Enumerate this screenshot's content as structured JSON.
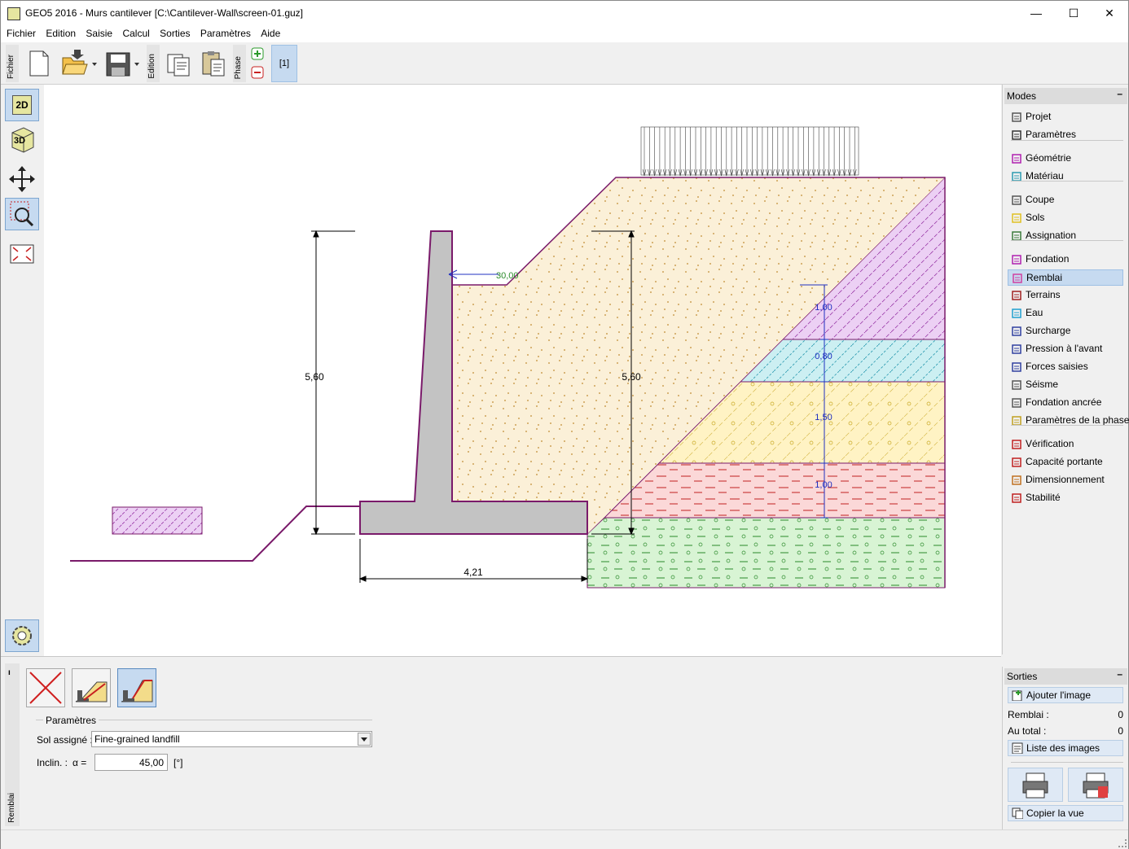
{
  "window": {
    "title": "GEO5 2016 - Murs cantilever [C:\\Cantilever-Wall\\screen-01.guz]",
    "minimize": "—",
    "maximize": "☐",
    "close": "✕"
  },
  "menu": [
    "Fichier",
    "Edition",
    "Saisie",
    "Calcul",
    "Sorties",
    "Paramètres",
    "Aide"
  ],
  "toolbar": {
    "group_fichier": "Fichier",
    "group_edition": "Edition",
    "group_phase": "Phase",
    "phase_label": "[1]"
  },
  "left_tools": {
    "btn_2d": "2D",
    "btn_3d": "3D"
  },
  "drawing": {
    "dim_wall_height": "5,60",
    "dim_backfill_height": "5,60",
    "dim_base_width": "4,21",
    "backfill_angle": "30,00",
    "layer_thickness_1": "1,00",
    "layer_thickness_2": "0,80",
    "layer_thickness_3": "1,50",
    "layer_thickness_4": "1,00",
    "colors": {
      "wall": "#c3c3c3",
      "backfill": "#fbf0d8",
      "soil_purple": "#e6c8f0",
      "soil_cyan": "#cceff2",
      "soil_yellow": "#fff3c4",
      "soil_pink": "#fbd8d8",
      "soil_green": "#d8f4d4",
      "outline": "#7a1a6a"
    }
  },
  "modes": {
    "header": "Modes",
    "items": [
      {
        "label": "Projet",
        "icon": "project-icon"
      },
      {
        "label": "Paramètres",
        "icon": "settings-icon"
      },
      {
        "label": "Géométrie",
        "icon": "geometry-icon"
      },
      {
        "label": "Matériau",
        "icon": "material-icon"
      },
      {
        "label": "Coupe",
        "icon": "profile-icon"
      },
      {
        "label": "Sols",
        "icon": "soils-icon"
      },
      {
        "label": "Assignation",
        "icon": "assign-icon"
      },
      {
        "label": "Fondation",
        "icon": "foundation-icon"
      },
      {
        "label": "Remblai",
        "icon": "backfill-icon"
      },
      {
        "label": "Terrains",
        "icon": "terrain-icon"
      },
      {
        "label": "Eau",
        "icon": "water-icon"
      },
      {
        "label": "Surcharge",
        "icon": "surcharge-icon"
      },
      {
        "label": "Pression à l'avant",
        "icon": "front-pressure-icon"
      },
      {
        "label": "Forces saisies",
        "icon": "forces-icon"
      },
      {
        "label": "Séisme",
        "icon": "earthquake-icon"
      },
      {
        "label": "Fondation ancrée",
        "icon": "anchored-foundation-icon"
      },
      {
        "label": "Paramètres de la phase",
        "icon": "phase-settings-icon"
      },
      {
        "label": "Vérification",
        "icon": "verification-icon"
      },
      {
        "label": "Capacité portante",
        "icon": "bearing-capacity-icon"
      },
      {
        "label": "Dimensionnement",
        "icon": "dimensioning-icon"
      },
      {
        "label": "Stabilité",
        "icon": "stability-icon"
      }
    ],
    "selected": "Remblai"
  },
  "remblai_panel": {
    "side_label": "Remblai",
    "group_title": "Paramètres",
    "sol_label": "Sol assigné :",
    "sol_value": "Fine-grained landfill",
    "inclin_label": "Inclin. :",
    "alpha_label": "α  =",
    "alpha_value": "45,00",
    "unit": "[°]"
  },
  "outputs": {
    "header": "Sorties",
    "add_image": "Ajouter l'image",
    "remblai_label": "Remblai :",
    "remblai_count": "0",
    "total_label": "Au total :",
    "total_count": "0",
    "image_list": "Liste des images",
    "copy_view": "Copier la vue"
  }
}
